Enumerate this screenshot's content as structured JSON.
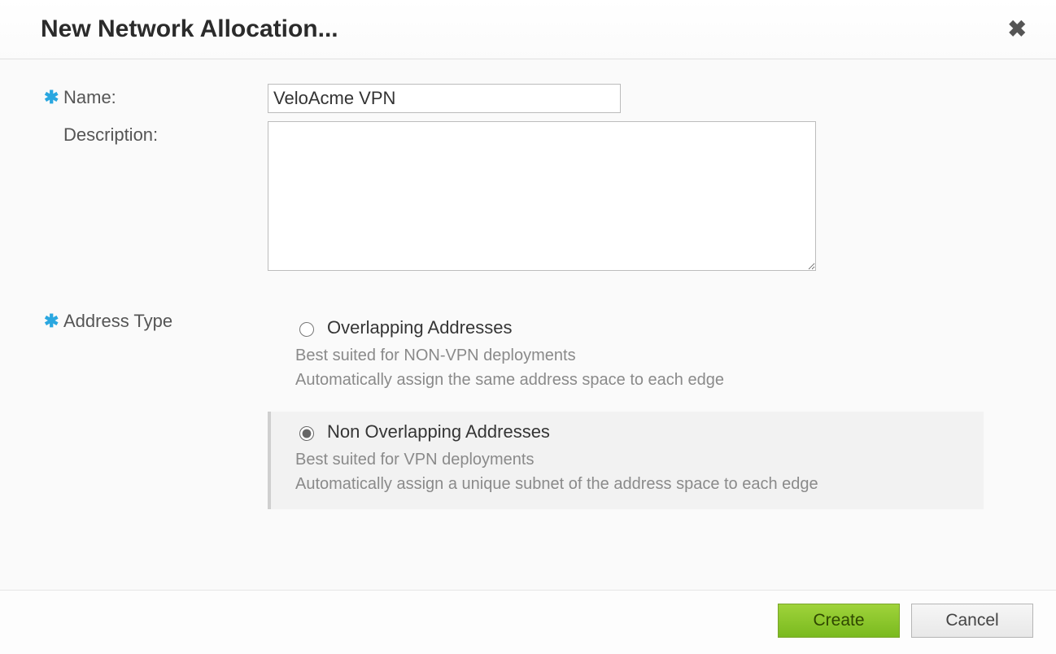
{
  "dialog": {
    "title": "New Network Allocation..."
  },
  "form": {
    "name_label": "Name:",
    "name_value": "VeloAcme VPN",
    "description_label": "Description:",
    "description_value": "",
    "address_type_label": "Address Type"
  },
  "address_type": {
    "overlapping": {
      "title": "Overlapping Addresses",
      "desc_line1": "Best suited for NON-VPN deployments",
      "desc_line2": "Automatically assign the same address space to each edge",
      "selected": false
    },
    "non_overlapping": {
      "title": "Non Overlapping Addresses",
      "desc_line1": "Best suited for VPN deployments",
      "desc_line2": "Automatically assign a unique subnet of the address space to each edge",
      "selected": true
    }
  },
  "footer": {
    "create_label": "Create",
    "cancel_label": "Cancel"
  },
  "icons": {
    "required": "✱",
    "close": "✖"
  }
}
